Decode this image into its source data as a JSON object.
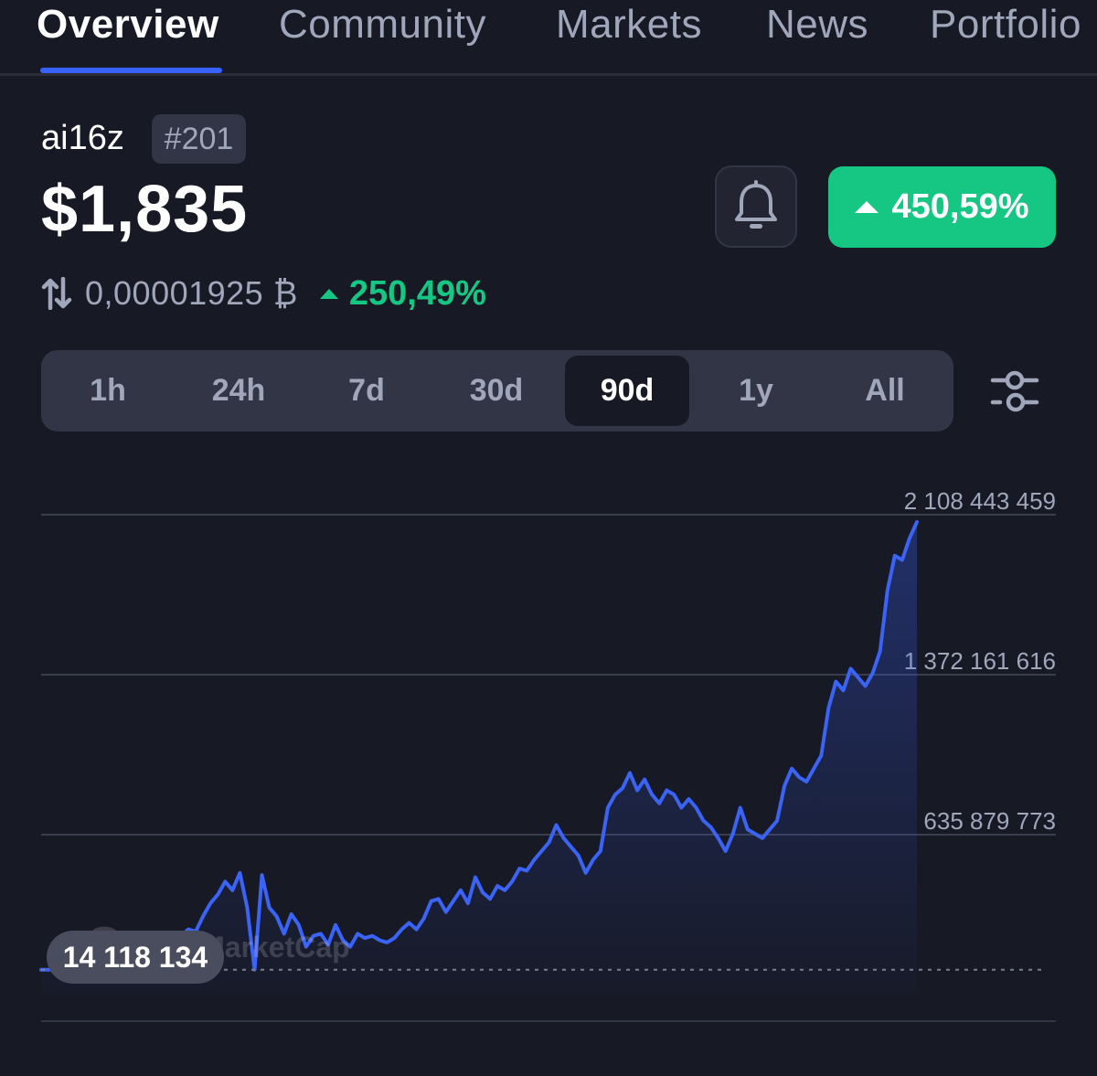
{
  "tabs": [
    {
      "label": "Overview",
      "active": true
    },
    {
      "label": "Community",
      "active": false
    },
    {
      "label": "Markets",
      "active": false
    },
    {
      "label": "News",
      "active": false
    },
    {
      "label": "Portfolio",
      "active": false
    }
  ],
  "coin": {
    "name": "ai16z",
    "rank": "#201",
    "price": "$1,835",
    "change": "450,59%",
    "btc_price": "0,00001925 ₿",
    "btc_change": "250,49%"
  },
  "ranges": [
    "1h",
    "24h",
    "7d",
    "30d",
    "90d",
    "1y",
    "All"
  ],
  "selected_range": "90d",
  "icons": {
    "alert": "bell-icon",
    "swap": "swap-arrows-icon",
    "settings": "sliders-icon",
    "up": "triangle-up-icon"
  },
  "colors": {
    "background": "#171924",
    "accent": "#3861fb",
    "positive": "#16c784"
  },
  "watermark": "CoinMarketCap",
  "current_value_label": "14 118 134",
  "chart_data": {
    "type": "area",
    "title": "",
    "xlabel": "",
    "ylabel": "",
    "grid": true,
    "y_ticks": [
      2108443459,
      1372161616,
      635879773
    ],
    "y_tick_labels": [
      "2 108 443 459",
      "1 372 161 616",
      "635 879 773"
    ],
    "ylim": [
      -100402070,
      2108443459
    ],
    "baseline_value": 14118134,
    "series": [
      {
        "values": [
          14000000,
          14118134,
          16000000,
          20000000,
          22000000,
          18000000,
          20000000,
          25000000,
          23000000,
          26000000,
          24000000,
          20000000,
          22000000,
          20000000,
          35000000,
          60000000,
          80000000,
          110000000,
          130000000,
          170000000,
          200000000,
          190000000,
          260000000,
          320000000,
          360000000,
          420000000,
          380000000,
          460000000,
          300000000,
          14000000,
          450000000,
          300000000,
          260000000,
          180000000,
          270000000,
          220000000,
          120000000,
          170000000,
          180000000,
          130000000,
          220000000,
          150000000,
          120000000,
          180000000,
          160000000,
          170000000,
          150000000,
          140000000,
          160000000,
          200000000,
          230000000,
          200000000,
          250000000,
          330000000,
          340000000,
          280000000,
          330000000,
          380000000,
          320000000,
          440000000,
          370000000,
          340000000,
          400000000,
          380000000,
          420000000,
          480000000,
          470000000,
          520000000,
          560000000,
          600000000,
          680000000,
          620000000,
          580000000,
          540000000,
          460000000,
          520000000,
          560000000,
          760000000,
          820000000,
          850000000,
          920000000,
          840000000,
          890000000,
          820000000,
          780000000,
          840000000,
          820000000,
          760000000,
          800000000,
          760000000,
          700000000,
          670000000,
          620000000,
          560000000,
          640000000,
          760000000,
          660000000,
          640000000,
          620000000,
          660000000,
          700000000,
          860000000,
          940000000,
          900000000,
          880000000,
          940000000,
          1000000000,
          1220000000,
          1340000000,
          1300000000,
          1400000000,
          1360000000,
          1320000000,
          1380000000,
          1480000000,
          1760000000,
          1920000000,
          1900000000,
          2000000000,
          2075000000
        ]
      }
    ]
  }
}
